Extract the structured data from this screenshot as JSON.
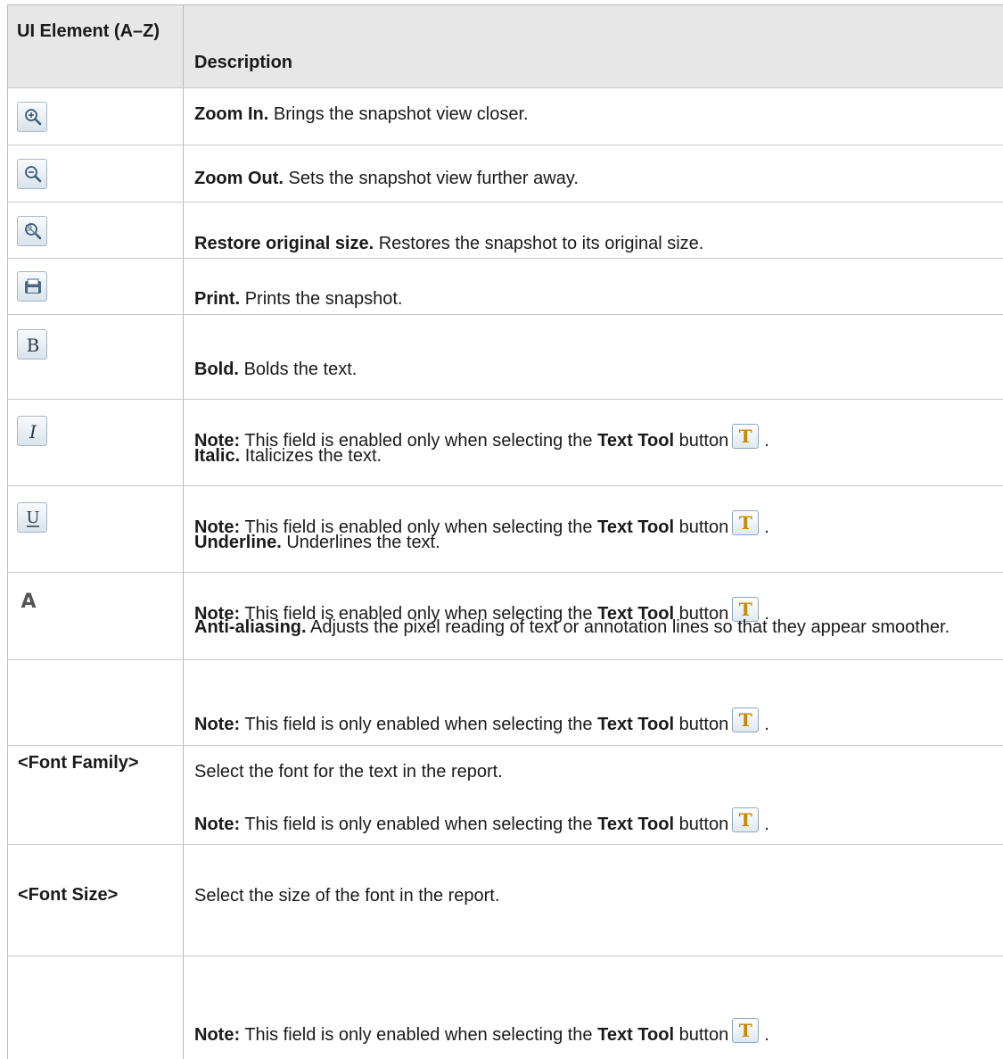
{
  "table": {
    "header": {
      "element": "UI Element (A–Z)",
      "description": "Description"
    },
    "rows": [
      {
        "icon": "zoom-in-icon",
        "title": "Zoom In.",
        "text": "Brings the snapshot view closer."
      },
      {
        "icon": "zoom-out-icon",
        "title": "Zoom Out.",
        "text": "Sets the snapshot view further away."
      },
      {
        "icon": "restore-size-icon",
        "title": "Restore original size.",
        "text": "Restores the snapshot to its original size."
      },
      {
        "icon": "print-icon",
        "title": "Print.",
        "text": "Prints the snapshot."
      },
      {
        "icon": "bold-icon",
        "title": "Bold.",
        "text": "Bolds the text."
      },
      {
        "icon": "italic-icon",
        "title": "Italic.",
        "text": "Italicizes the text."
      },
      {
        "icon": "underline-icon",
        "title": "Underline.",
        "text": "Underlines the text."
      },
      {
        "icon": "anti-aliasing-icon",
        "title": "Anti-aliasing.",
        "text": "Adjusts the pixel reading of text or annotation lines so that they appear smoother."
      },
      {
        "label": "<Font Family>",
        "text": "Select the font for the text in the report."
      },
      {
        "label": "<Font Size>",
        "text": "Select the size of the font in the report."
      }
    ],
    "notes": {
      "prefix": "Note:",
      "enabled_only": "This field is enabled only when selecting the",
      "only_enabled": "This field is only enabled when selecting the",
      "tool_name": "Text Tool",
      "suffix": "button",
      "period": "."
    },
    "text_tool_icon": {
      "icon": "text-tool-icon",
      "glyph": "T"
    }
  }
}
